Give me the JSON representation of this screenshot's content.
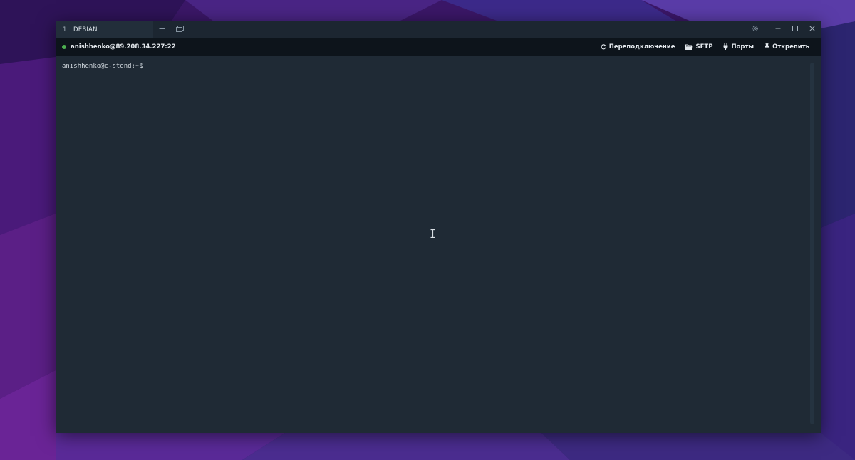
{
  "tab": {
    "number": "1",
    "title": "DEBIAN"
  },
  "titlebar": {
    "new_tab_icon": "plus-icon",
    "tab_overview_icon": "windows-icon",
    "settings_icon": "gear-icon",
    "minimize_icon": "minimize-icon",
    "maximize_icon": "maximize-icon",
    "close_icon": "close-icon"
  },
  "connection": {
    "status_color": "#4caf50",
    "host": "anishhenko@89.208.34.227:22"
  },
  "actions": [
    {
      "label": "Переподключение",
      "icon": "refresh-icon"
    },
    {
      "label": "SFTP",
      "icon": "folder-icon"
    },
    {
      "label": "Порты",
      "icon": "plug-icon"
    },
    {
      "label": "Открепить",
      "icon": "pin-icon"
    }
  ],
  "terminal": {
    "prompt": "anishhenko@c-stend:~$"
  },
  "colors": {
    "accent_cursor": "#e0a030",
    "terminal_bg": "#1f2a35",
    "infobar_bg": "#0d141b"
  }
}
